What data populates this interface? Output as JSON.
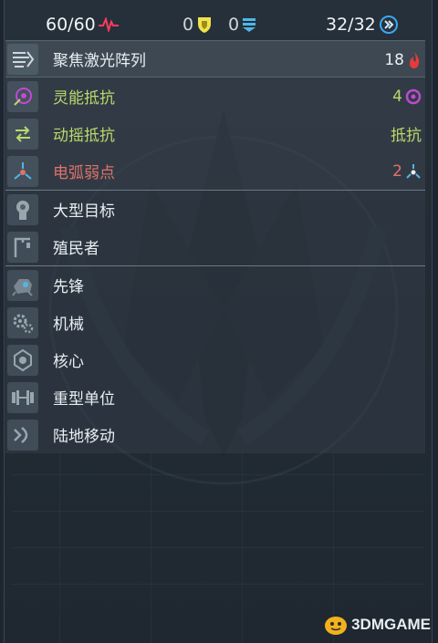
{
  "header": {
    "health": "60/60",
    "shield": "0",
    "armor": "0",
    "energy": "32/32"
  },
  "rows": [
    {
      "label": "聚焦激光阵列",
      "value": "18",
      "icon": "laser-icon",
      "value_icon": "flame-icon"
    },
    {
      "label": "灵能抵抗",
      "value": "4",
      "icon": "psi-icon",
      "value_icon": "psi-swirl-icon"
    },
    {
      "label": "动摇抵抗",
      "value": "抵抗",
      "icon": "stagger-icon"
    },
    {
      "label": "电弧弱点",
      "value": "2",
      "icon": "arc-icon",
      "value_icon": "arc-small-icon"
    },
    {
      "label": "大型目标",
      "icon": "large-target-icon"
    },
    {
      "label": "殖民者",
      "icon": "colonist-icon"
    },
    {
      "label": "先锋",
      "icon": "vanguard-icon"
    },
    {
      "label": "机械",
      "icon": "mechanical-icon"
    },
    {
      "label": "核心",
      "icon": "core-icon"
    },
    {
      "label": "重型单位",
      "icon": "heavy-unit-icon"
    },
    {
      "label": "陆地移动",
      "icon": "ground-move-icon"
    }
  ],
  "watermark": "3DMGAME",
  "colors": {
    "health": "#ff3b5c",
    "shield": "#f2e34a",
    "armor": "#4fb7e8",
    "energy": "#3aa8f0",
    "psi": "#b9d96c",
    "arc": "#e0726a",
    "flame": "#e83a3a",
    "swirl": "#c04ad0"
  }
}
